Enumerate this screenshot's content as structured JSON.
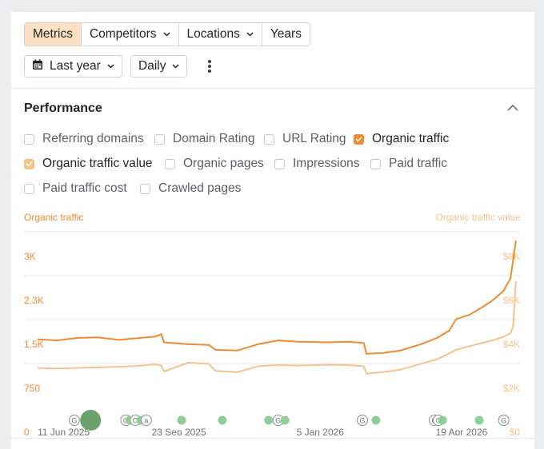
{
  "toolbar": {
    "tabs": [
      {
        "label": "Metrics",
        "active": true,
        "dropdown": false
      },
      {
        "label": "Competitors",
        "active": false,
        "dropdown": true
      },
      {
        "label": "Locations",
        "active": false,
        "dropdown": true
      },
      {
        "label": "Years",
        "active": false,
        "dropdown": false
      }
    ],
    "period": {
      "label": "Last year",
      "icon": "calendar-icon"
    },
    "interval": {
      "label": "Daily"
    },
    "more_icon": "more-vertical-icon"
  },
  "performance": {
    "title": "Performance",
    "collapse_icon": "chevron-up-icon",
    "checkboxes": [
      {
        "label": "Referring domains",
        "checked": false
      },
      {
        "label": "Domain Rating",
        "checked": false
      },
      {
        "label": "URL Rating",
        "checked": false
      },
      {
        "label": "Organic traffic",
        "checked": true
      },
      {
        "label": "Organic traffic value",
        "checked": true
      },
      {
        "label": "Organic pages",
        "checked": false
      },
      {
        "label": "Impressions",
        "checked": false
      },
      {
        "label": "Paid traffic",
        "checked": false
      },
      {
        "label": "Paid traffic cost",
        "checked": false
      },
      {
        "label": "Crawled pages",
        "checked": false
      }
    ]
  },
  "colors": {
    "organic_traffic": "#ee8a2f",
    "organic_traffic_value": "#f4c38a",
    "marker_green": "#8fcf95",
    "marker_big_green": "#6aa36e",
    "active_tab_bg": "#fde1c2"
  },
  "chart_data": {
    "type": "line",
    "left_axis_label": "Organic traffic",
    "right_axis_label": "Organic traffic value",
    "left_ticks": [
      "3K",
      "2.3K",
      "1.5K",
      "750",
      "0"
    ],
    "right_ticks": [
      "$8K",
      "$6K",
      "$4K",
      "$2K",
      "$0"
    ],
    "x_ticks": [
      "11 Jun 2025",
      "23 Sep 2025",
      "5 Jan 2026",
      "19 Apr 2026"
    ],
    "y_left_range": [
      0,
      3000
    ],
    "y_right_range": [
      0,
      8000
    ],
    "x_range": [
      "2025-06-01",
      "2026-06-01"
    ],
    "grid": true,
    "series": [
      {
        "name": "Organic traffic",
        "axis": "left",
        "points": [
          [
            "2025-06-11",
            1480
          ],
          [
            "2025-06-25",
            1460
          ],
          [
            "2025-07-10",
            1500
          ],
          [
            "2025-07-25",
            1510
          ],
          [
            "2025-08-10",
            1470
          ],
          [
            "2025-08-20",
            1490
          ],
          [
            "2025-09-05",
            1520
          ],
          [
            "2025-09-10",
            1560
          ],
          [
            "2025-09-12",
            1430
          ],
          [
            "2025-09-30",
            1400
          ],
          [
            "2025-10-15",
            1390
          ],
          [
            "2025-10-20",
            1310
          ],
          [
            "2025-11-05",
            1300
          ],
          [
            "2025-11-20",
            1400
          ],
          [
            "2025-12-05",
            1460
          ],
          [
            "2025-12-20",
            1440
          ],
          [
            "2026-01-10",
            1430
          ],
          [
            "2026-01-25",
            1440
          ],
          [
            "2026-02-06",
            1420
          ],
          [
            "2026-02-08",
            1250
          ],
          [
            "2026-02-20",
            1260
          ],
          [
            "2026-03-05",
            1300
          ],
          [
            "2026-03-20",
            1400
          ],
          [
            "2026-04-01",
            1500
          ],
          [
            "2026-04-10",
            1620
          ],
          [
            "2026-04-15",
            1800
          ],
          [
            "2026-04-25",
            1870
          ],
          [
            "2026-05-05",
            2000
          ],
          [
            "2026-05-12",
            2100
          ],
          [
            "2026-05-20",
            2250
          ],
          [
            "2026-05-25",
            2450
          ],
          [
            "2026-05-27",
            2750
          ],
          [
            "2026-05-29",
            3050
          ]
        ]
      },
      {
        "name": "Organic traffic value",
        "axis": "right",
        "points": [
          [
            "2025-06-11",
            2730
          ],
          [
            "2025-06-25",
            2700
          ],
          [
            "2025-07-10",
            2730
          ],
          [
            "2025-07-25",
            2750
          ],
          [
            "2025-08-10",
            2780
          ],
          [
            "2025-08-20",
            2800
          ],
          [
            "2025-09-05",
            2870
          ],
          [
            "2025-09-10",
            2830
          ],
          [
            "2025-09-12",
            2580
          ],
          [
            "2025-09-30",
            2950
          ],
          [
            "2025-10-15",
            2900
          ],
          [
            "2025-10-20",
            2600
          ],
          [
            "2025-11-05",
            2550
          ],
          [
            "2025-11-20",
            2800
          ],
          [
            "2025-12-05",
            2850
          ],
          [
            "2025-12-20",
            2830
          ],
          [
            "2026-01-10",
            2860
          ],
          [
            "2026-01-25",
            2850
          ],
          [
            "2026-02-06",
            2800
          ],
          [
            "2026-02-08",
            2480
          ],
          [
            "2026-02-20",
            2550
          ],
          [
            "2026-03-05",
            2650
          ],
          [
            "2026-03-20",
            2900
          ],
          [
            "2026-04-01",
            3100
          ],
          [
            "2026-04-10",
            3350
          ],
          [
            "2026-04-15",
            3500
          ],
          [
            "2026-04-25",
            3650
          ],
          [
            "2026-05-05",
            3800
          ],
          [
            "2026-05-12",
            3900
          ],
          [
            "2026-05-20",
            4050
          ],
          [
            "2026-05-25",
            4200
          ],
          [
            "2026-05-27",
            4500
          ],
          [
            "2026-05-29",
            6400
          ]
        ]
      }
    ],
    "annotations": [
      {
        "date": "2025-07-08",
        "kind": "google-update",
        "glyph": "G"
      },
      {
        "date": "2025-07-20",
        "kind": "event",
        "size": "large"
      },
      {
        "date": "2025-08-15",
        "kind": "google-update",
        "glyph": "G"
      },
      {
        "date": "2025-08-18",
        "kind": "event"
      },
      {
        "date": "2025-08-22",
        "kind": "google-update",
        "glyph": "G"
      },
      {
        "date": "2025-08-26",
        "kind": "event"
      },
      {
        "date": "2025-08-30",
        "kind": "ahrefs-update",
        "glyph": "a"
      },
      {
        "date": "2025-09-25",
        "kind": "event"
      },
      {
        "date": "2025-10-25",
        "kind": "event"
      },
      {
        "date": "2025-11-28",
        "kind": "event"
      },
      {
        "date": "2025-12-05",
        "kind": "google-update",
        "glyph": "G"
      },
      {
        "date": "2025-12-10",
        "kind": "event"
      },
      {
        "date": "2026-02-05",
        "kind": "google-update",
        "glyph": "G"
      },
      {
        "date": "2026-02-15",
        "kind": "event"
      },
      {
        "date": "2026-03-30",
        "kind": "google-update",
        "glyph": "G"
      },
      {
        "date": "2026-04-02",
        "kind": "google-update",
        "glyph": "G"
      },
      {
        "date": "2026-04-05",
        "kind": "event"
      },
      {
        "date": "2026-05-02",
        "kind": "event"
      },
      {
        "date": "2026-05-20",
        "kind": "google-update",
        "glyph": "G"
      }
    ]
  }
}
